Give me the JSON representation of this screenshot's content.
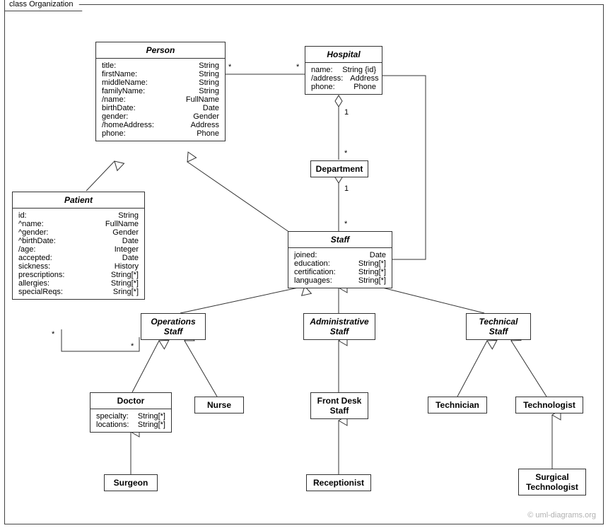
{
  "frame": {
    "title": "class Organization"
  },
  "classes": {
    "person": {
      "name": "Person",
      "attrs": [
        [
          "title:",
          "String"
        ],
        [
          "firstName:",
          "String"
        ],
        [
          "middleName:",
          "String"
        ],
        [
          "familyName:",
          "String"
        ],
        [
          "/name:",
          "FullName"
        ],
        [
          "birthDate:",
          "Date"
        ],
        [
          "gender:",
          "Gender"
        ],
        [
          "/homeAddress:",
          "Address"
        ],
        [
          "phone:",
          "Phone"
        ]
      ]
    },
    "hospital": {
      "name": "Hospital",
      "attrs": [
        [
          "name:",
          "String {id}"
        ],
        [
          "/address:",
          "Address"
        ],
        [
          "phone:",
          "Phone"
        ]
      ]
    },
    "department": {
      "name": "Department"
    },
    "patient": {
      "name": "Patient",
      "attrs": [
        [
          "id:",
          "String"
        ],
        [
          "^name:",
          "FullName"
        ],
        [
          "^gender:",
          "Gender"
        ],
        [
          "^birthDate:",
          "Date"
        ],
        [
          "/age:",
          "Integer"
        ],
        [
          "accepted:",
          "Date"
        ],
        [
          "sickness:",
          "History"
        ],
        [
          "prescriptions:",
          "String[*]"
        ],
        [
          "allergies:",
          "String[*]"
        ],
        [
          "specialReqs:",
          "Sring[*]"
        ]
      ]
    },
    "staff": {
      "name": "Staff",
      "attrs": [
        [
          "joined:",
          "Date"
        ],
        [
          "education:",
          "String[*]"
        ],
        [
          "certification:",
          "String[*]"
        ],
        [
          "languages:",
          "String[*]"
        ]
      ]
    },
    "operations_staff": {
      "name": "Operations\nStaff"
    },
    "administrative_staff": {
      "name": "Administrative\nStaff"
    },
    "technical_staff": {
      "name": "Technical\nStaff"
    },
    "doctor": {
      "name": "Doctor",
      "attrs": [
        [
          "specialty:",
          "String[*]"
        ],
        [
          "locations:",
          "String[*]"
        ]
      ]
    },
    "nurse": {
      "name": "Nurse"
    },
    "front_desk_staff": {
      "name": "Front Desk\nStaff"
    },
    "technician": {
      "name": "Technician"
    },
    "technologist": {
      "name": "Technologist"
    },
    "surgeon": {
      "name": "Surgeon"
    },
    "receptionist": {
      "name": "Receptionist"
    },
    "surgical_technologist": {
      "name": "Surgical\nTechnologist"
    }
  },
  "multiplicities": {
    "ph_star_l": "*",
    "ph_star_r": "*",
    "hd_one": "1",
    "hd_star": "*",
    "ds_one": "1",
    "ds_star": "*",
    "po_star_t": "*",
    "po_star_b": "*"
  },
  "copyright": "© uml-diagrams.org"
}
